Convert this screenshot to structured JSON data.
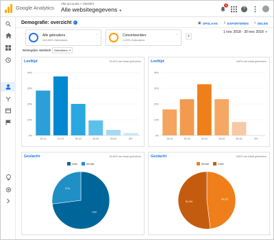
{
  "app": {
    "brand": "Google Analytics",
    "breadcrumb": "Alle accounts > Slotshirt",
    "view": "Alle websitegegevens"
  },
  "topbar": {
    "notification_count": "5",
    "icons": [
      "bell-icon",
      "apps-grid-icon",
      "help-icon",
      "more-vert-icon",
      "account-avatar"
    ]
  },
  "leftnav": {
    "items": [
      "search-icon",
      "home-icon",
      "customization-icon",
      "realtime-icon",
      "audience-icon",
      "acquisition-icon",
      "behavior-icon",
      "conversions-icon",
      "discover-icon",
      "admin-icon",
      "expand-icon"
    ],
    "active": "audience-icon"
  },
  "header": {
    "title": "Demografie: overzicht",
    "actions": {
      "save": "OPSLAAN",
      "export": "EXPORTEREN",
      "share": "DELEN"
    }
  },
  "segments": [
    {
      "name": "Alle gebruikers",
      "sub": "100,00% Gebruikers",
      "color": "#1a73e8"
    },
    {
      "name": "Converteerders",
      "sub": "2,20% Gebruikers",
      "color": "#ff9800"
    }
  ],
  "date_range": "1 nov. 2018 - 30 nov. 2018",
  "key_metric": {
    "label": "Belangrijke statistiek:",
    "value": "Gebruikers"
  },
  "panels": {
    "age_all": {
      "title": "Leeftijd",
      "subtitle": "23,44% van totaal gebruikers"
    },
    "age_conv": {
      "title": "Leeftijd",
      "subtitle": "3,80% van totaal gebruikers"
    },
    "gender_all": {
      "title": "Geslacht",
      "subtitle": "26,46% van totaal gebruikers"
    },
    "gender_conv": {
      "title": "Geslacht",
      "subtitle": "3,80% van totaal gebruikers"
    }
  },
  "chart_data": [
    {
      "type": "bar",
      "title": "Leeftijd",
      "categories": [
        "18-24",
        "25-34",
        "35-44",
        "45-54",
        "55-64",
        "65+"
      ],
      "values": [
        28.5,
        37.5,
        20.0,
        9.5,
        3.5,
        1.5
      ],
      "ylim": [
        0,
        40
      ],
      "yticks": [
        "0%",
        "10%",
        "20%",
        "30%",
        "40%"
      ],
      "colors": [
        "#2d9fd8",
        "#0288d1",
        "#29a8e0",
        "#5dc0ea",
        "#a5d9f2",
        "#c8e9f8"
      ]
    },
    {
      "type": "bar",
      "title": "Leeftijd",
      "categories": [
        "18-24",
        "25-34",
        "35-44",
        "45-54",
        "55-64",
        "65+"
      ],
      "values": [
        16.5,
        23.0,
        32.5,
        23.0,
        8.5,
        0
      ],
      "ylim": [
        0,
        40
      ],
      "yticks": [
        "0%",
        "10%",
        "20%",
        "30%",
        "40%"
      ],
      "colors": [
        "#f4a460",
        "#f29a50",
        "#ef7f1a",
        "#f4a864",
        "#f7c9a4",
        "#fde3cf"
      ]
    },
    {
      "type": "pie",
      "title": "Geslacht",
      "labels": [
        "male",
        "female"
      ],
      "values": [
        73,
        27
      ],
      "value_labels": [
        "73%",
        "27%"
      ],
      "colors": [
        "#006699",
        "#1f8fc4"
      ]
    },
    {
      "type": "pie",
      "title": "Geslacht",
      "labels": [
        "female",
        "male"
      ],
      "values": [
        48.1,
        51.9
      ],
      "value_labels": [
        "48,1%",
        "51,9%"
      ],
      "colors": [
        "#ef7f1a",
        "#c45c0f"
      ]
    }
  ]
}
